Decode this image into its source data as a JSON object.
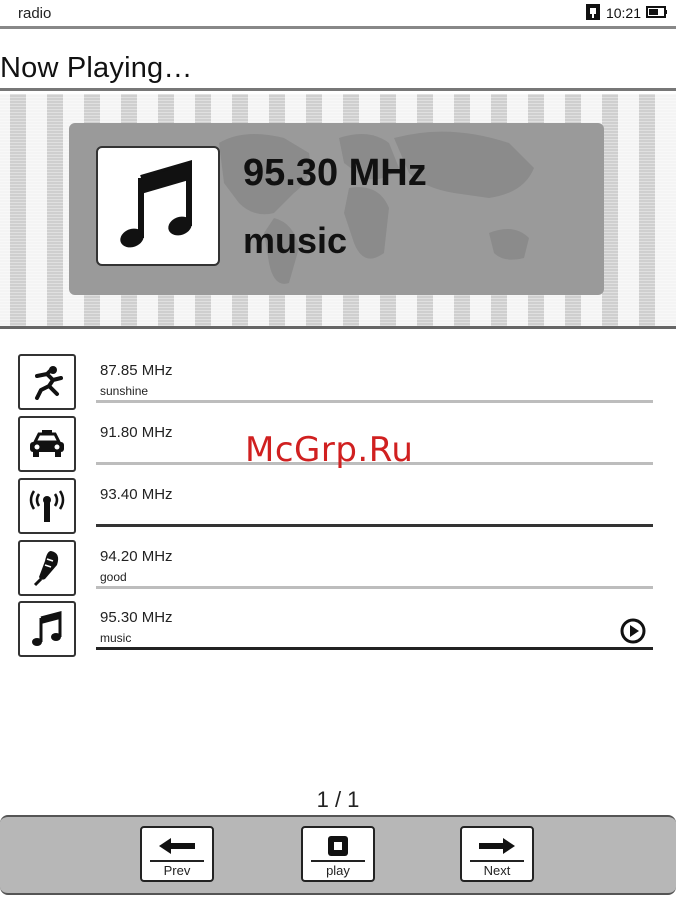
{
  "status_bar": {
    "app_name": "radio",
    "time": "10:21"
  },
  "page_title": "Now Playing…",
  "now_playing": {
    "frequency": "95.30 MHz",
    "name": "music"
  },
  "stations": [
    {
      "frequency": "87.85 MHz",
      "name": "sunshine",
      "icon": "runner-icon"
    },
    {
      "frequency": "91.80 MHz",
      "name": "",
      "icon": "car-icon"
    },
    {
      "frequency": "93.40 MHz",
      "name": "",
      "icon": "antenna-icon"
    },
    {
      "frequency": "94.20 MHz",
      "name": "good",
      "icon": "microphone-icon"
    },
    {
      "frequency": "95.30 MHz",
      "name": "music",
      "icon": "music-note-icon",
      "playing": true
    }
  ],
  "watermark": "McGrp.Ru",
  "pager": "1 / 1",
  "toolbar": {
    "prev_label": "Prev",
    "play_label": "play",
    "next_label": "Next"
  },
  "colors": {
    "bar_gray": "#b7b7b7",
    "panel_gray": "#9a9a9a",
    "watermark_red": "#d02020"
  }
}
